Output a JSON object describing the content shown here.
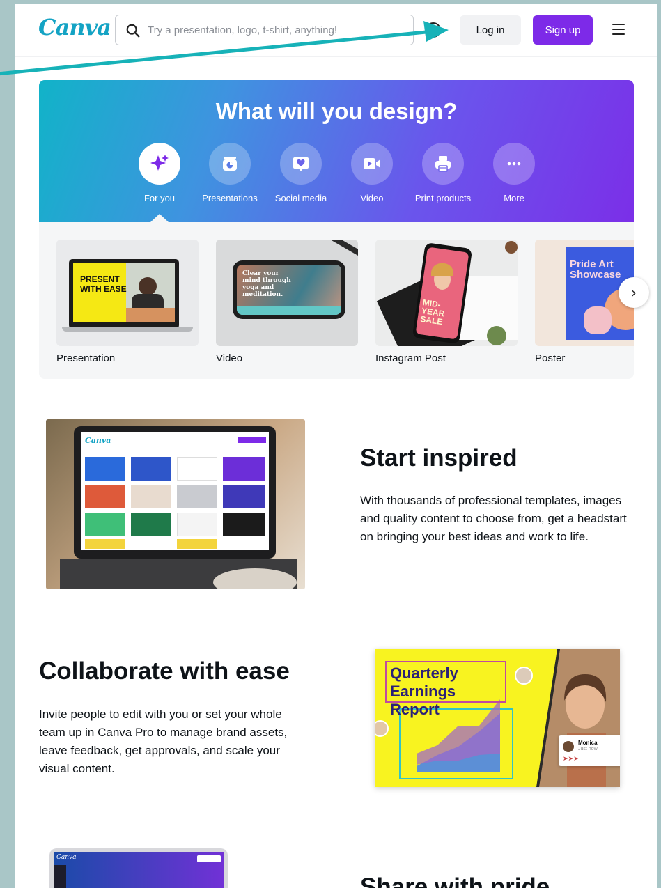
{
  "header": {
    "logo": "Canva",
    "search_placeholder": "Try a presentation, logo, t-shirt, anything!",
    "login_label": "Log in",
    "signup_label": "Sign up"
  },
  "hero": {
    "title": "What will you design?",
    "categories": [
      {
        "label": "For you",
        "icon": "sparkle-icon"
      },
      {
        "label": "Presentations",
        "icon": "presentation-icon"
      },
      {
        "label": "Social media",
        "icon": "heart-chat-icon"
      },
      {
        "label": "Video",
        "icon": "video-camera-icon"
      },
      {
        "label": "Print products",
        "icon": "printer-icon"
      },
      {
        "label": "More",
        "icon": "more-dots-icon"
      }
    ]
  },
  "templates": [
    {
      "name": "Presentation",
      "thumb_text": "PRESENT WITH EASE"
    },
    {
      "name": "Video",
      "thumb_text": "Clear your mind through yoga and meditation."
    },
    {
      "name": "Instagram Post",
      "thumb_text": "MID-YEAR SALE"
    },
    {
      "name": "Poster",
      "thumb_text": "Pride Art Showcase"
    }
  ],
  "features": [
    {
      "title": "Start inspired",
      "text": "With thousands of professional templates, images and quality content to choose from, get a headstart on bringing your best ideas and work to life."
    },
    {
      "title": "Collaborate with ease",
      "text": "Invite people to edit with you or set your whole team up in Canva Pro to manage brand assets, leave feedback, get approvals, and scale your visual content.",
      "image_title": "Quarterly Earnings Report",
      "comment_name": "Monica",
      "comment_time": "Just now"
    },
    {
      "title": "Share with pride"
    }
  ],
  "colors": {
    "brand_purple": "#7d2ae8",
    "logo_teal": "#14a3c4",
    "annotation_arrow": "#17b2b8"
  }
}
